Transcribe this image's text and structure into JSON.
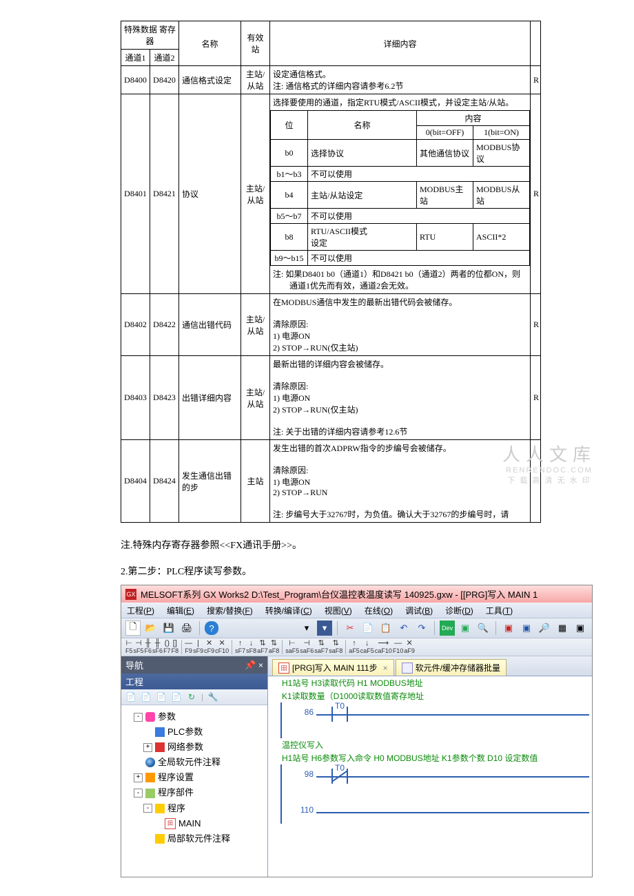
{
  "table1": {
    "headers": {
      "reg": "特殊数据\n寄存器",
      "ch1": "通道1",
      "ch2": "通道2",
      "name": "名称",
      "station": "有效站",
      "detail": "详细内容",
      "last": ""
    },
    "rows": [
      {
        "c1": "D8400",
        "c2": "D8420",
        "name": "通信格式设定",
        "st": "主站/\n从站",
        "d": "设定通信格式。\n注: 通信格式的详细内容请参考6.2节",
        "last": "R"
      },
      {
        "c1": "D8401",
        "c2": "D8421",
        "name": "协议",
        "st": "主站/\n从站",
        "last": "R",
        "pre": "选择要使用的通道，指定RTU模式/ASCII模式，并设定主站/从站。",
        "note": "注: 如果D8401 b0（通道1）和D8421 b0（通道2）两者的位都ON，则\n　　通道1优先而有效，通道2会无效。",
        "sub": {
          "h_bit": "位",
          "h_name": "名称",
          "h_content": "内容",
          "h_off": "0(bit=OFF)",
          "h_on": "1(bit=ON)",
          "r": [
            {
              "b": "b0",
              "n": "选择协议",
              "off": "其他通信协议",
              "on": "MODBUS协议"
            },
            {
              "b": "b1～b3",
              "n": "不可以使用",
              "off": "",
              "on": ""
            },
            {
              "b": "b4",
              "n": "主站/从站设定",
              "off": "MODBUS主站",
              "on": "MODBUS从站"
            },
            {
              "b": "b5～b7",
              "n": "不可以使用",
              "off": "",
              "on": ""
            },
            {
              "b": "b8",
              "n": "RTU/ASCII模式\n设定",
              "off": "RTU",
              "on": "ASCII*2"
            },
            {
              "b": "b9～b15",
              "n": "不可以使用",
              "off": "",
              "on": ""
            }
          ]
        }
      },
      {
        "c1": "D8402",
        "c2": "D8422",
        "name": "通信出错代码",
        "st": "主站/\n从站",
        "d": "在MODBUS通信中发生的最新出错代码会被储存。\n\n清除原因:\n1) 电源ON\n2) STOP→RUN(仅主站)",
        "last": "R"
      },
      {
        "c1": "D8403",
        "c2": "D8423",
        "name": "出错详细内容",
        "st": "主站/\n从站",
        "d": "最新出错的详细内容会被储存。\n\n清除原因:\n1) 电源ON\n2) STOP→RUN(仅主站)\n\n注: 关于出错的详细内容请参考12.6节",
        "last": "R"
      },
      {
        "c1": "D8404",
        "c2": "D8424",
        "name": "发生通信出错的步",
        "st": "主站",
        "d": "发生出错的首次ADPRW指令的步编号会被储存。\n\n清除原因:\n1) 电源ON\n2) STOP→RUN\n\n注: 步编号大于32767时，为负值。确认大于32767的步编号时，请",
        "last": ""
      }
    ]
  },
  "text": {
    "note": "注.特殊内存寄存器参照<<FX通讯手册>>。",
    "step2": "2.第二步：PLC程序读写参数。"
  },
  "app": {
    "title": "MELSOFT系列 GX Works2 D:\\Test_Program\\台仪温控表温度读写 140925.gxw - [[PRG]写入 MAIN 1",
    "menus": [
      {
        "t": "工程",
        "k": "P"
      },
      {
        "t": "编辑",
        "k": "E"
      },
      {
        "t": "搜索/替换",
        "k": "F"
      },
      {
        "t": "转换/编译",
        "k": "C"
      },
      {
        "t": "视图",
        "k": "V"
      },
      {
        "t": "在线",
        "k": "O"
      },
      {
        "t": "调试",
        "k": "B"
      },
      {
        "t": "诊断",
        "k": "D"
      },
      {
        "t": "工具",
        "k": "T"
      }
    ],
    "fkeys": [
      "F5",
      "sF5",
      "F6",
      "sF6",
      "F7",
      "F8",
      "",
      "F9",
      "sF9",
      "cF9",
      "cF10",
      "",
      "sF7",
      "sF8",
      "aF7",
      "aF8",
      "",
      "saF5",
      "saF6",
      "saF7",
      "saF8",
      "",
      "aF5",
      "caF5",
      "caF10",
      "F10",
      "aF9"
    ],
    "nav": {
      "title": "导航",
      "pin": "📌",
      "x": "×",
      "project": "工程",
      "tree": [
        {
          "exp": "-",
          "ic": "pink",
          "label": "参数",
          "children": [
            {
              "ic": "blue",
              "label": "PLC参数"
            },
            {
              "exp": "+",
              "ic": "red",
              "label": "网络参数"
            }
          ]
        },
        {
          "ic": "globe",
          "label": "全局软元件注释"
        },
        {
          "exp": "+",
          "ic": "orange",
          "label": "程序设置"
        },
        {
          "exp": "-",
          "ic": "green",
          "label": "程序部件",
          "children": [
            {
              "exp": "-",
              "ic": "yel",
              "label": "程序",
              "children": [
                {
                  "ic": "lad",
                  "label": "MAIN"
                }
              ]
            },
            {
              "ic": "yel",
              "label": "局部软元件注释"
            }
          ]
        }
      ]
    },
    "tabs": [
      {
        "t": "[PRG]写入 MAIN 111步",
        "kind": "lad"
      },
      {
        "t": "软元件/缓冲存储器批量",
        "kind": "mem"
      }
    ],
    "ladder": {
      "c1": "H1站号 H3读取代码 H1 MODBUS地址",
      "c2": "K1读取数量（D1000读取数值寄存地址",
      "r1": {
        "num": "86",
        "coil": "T0"
      },
      "c3": "温控仪写入",
      "c4": "H1站号 H6参数写入命令 H0 MODBUS地址 K1参数个数 D10 设定数值",
      "r2": {
        "num": "98",
        "coil": "T0"
      },
      "r3": {
        "num": "110"
      }
    }
  },
  "watermark": {
    "big": "人人文库",
    "s1": "RENRENDOC.COM",
    "s2": "下 载 高 清 无 水 印"
  }
}
